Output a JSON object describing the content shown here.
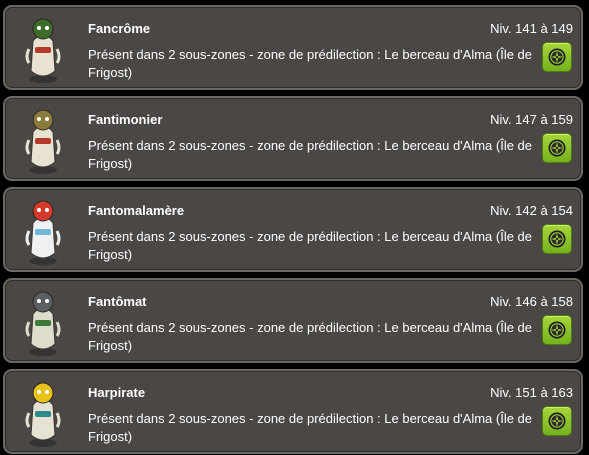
{
  "monsters": [
    {
      "name": "Fancrôme",
      "level": "Niv. 141 à 149",
      "description": "Présent dans 2 sous-zones - zone de prédilection : Le berceau d'Alma (Île de Frigost)",
      "avatar_icon": "fancrome-avatar-icon",
      "avatar_colors": {
        "body": "#e8e2d2",
        "accent": "#3d6b2a",
        "detail": "#b43a2a"
      },
      "map_icon": "compass-icon"
    },
    {
      "name": "Fantimonier",
      "level": "Niv. 147 à 159",
      "description": "Présent dans 2 sous-zones - zone de prédilection : Le berceau d'Alma (Île de Frigost)",
      "avatar_icon": "fantimonier-avatar-icon",
      "avatar_colors": {
        "body": "#e8e2d2",
        "accent": "#8a7a3a",
        "detail": "#b43a2a"
      },
      "map_icon": "compass-icon"
    },
    {
      "name": "Fantomalamère",
      "level": "Niv. 142 à 154",
      "description": "Présent dans 2 sous-zones - zone de prédilection : Le berceau d'Alma (Île de Frigost)",
      "avatar_icon": "fantomalamere-avatar-icon",
      "avatar_colors": {
        "body": "#eef0f2",
        "accent": "#d33a2a",
        "detail": "#6fb8d8"
      },
      "map_icon": "compass-icon"
    },
    {
      "name": "Fantômat",
      "level": "Niv. 146 à 158",
      "description": "Présent dans 2 sous-zones - zone de prédilection : Le berceau d'Alma (Île de Frigost)",
      "avatar_icon": "fantomat-avatar-icon",
      "avatar_colors": {
        "body": "#e0dccc",
        "accent": "#5b5f62",
        "detail": "#3d7a3a"
      },
      "map_icon": "compass-icon"
    },
    {
      "name": "Harpirate",
      "level": "Niv. 151 à 163",
      "description": "Présent dans 2 sous-zones - zone de prédilection : Le berceau d'Alma (Île de Frigost)",
      "avatar_icon": "harpirate-avatar-icon",
      "avatar_colors": {
        "body": "#e6e2d4",
        "accent": "#e8c21a",
        "detail": "#2f8a8a"
      },
      "map_icon": "compass-icon"
    }
  ],
  "colors": {
    "card_bg": "#4a4744",
    "card_border": "#6c6862",
    "text": "#ffffff",
    "button_green": "#8cc92b"
  }
}
